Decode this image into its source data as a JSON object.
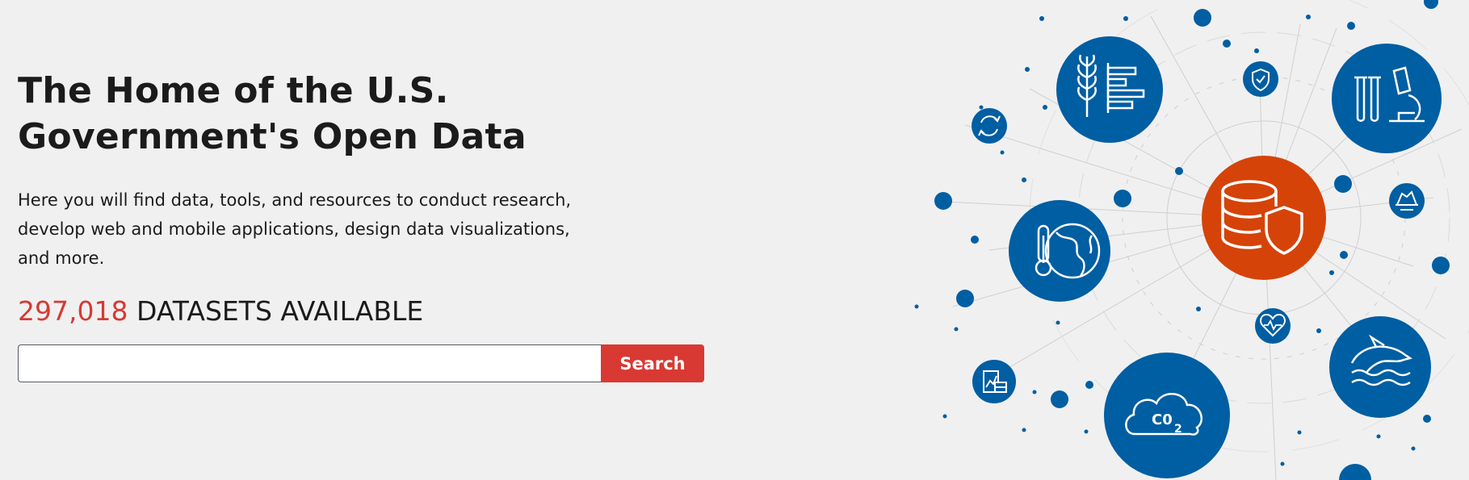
{
  "hero": {
    "title": "The Home of the U.S. Government's Open Data",
    "intro": "Here you will find data, tools, and resources to conduct research, develop web and mobile applications, design data visualizations, and more.",
    "dataset_count": "297,018",
    "dataset_label": "DATASETS AVAILABLE"
  },
  "search": {
    "value": "",
    "placeholder": "",
    "button_label": "Search"
  },
  "colors": {
    "accent_red": "#d83933",
    "icon_blue": "#005ea2",
    "center_orange": "#d54309"
  },
  "icons": [
    "database-shield-icon",
    "agriculture-data-icon",
    "laboratory-icon",
    "climate-globe-icon",
    "marine-dolphin-icon",
    "co2-cloud-icon",
    "shield-check-icon",
    "recycle-icon",
    "iceberg-icon",
    "heart-health-icon",
    "finance-chart-icon"
  ]
}
